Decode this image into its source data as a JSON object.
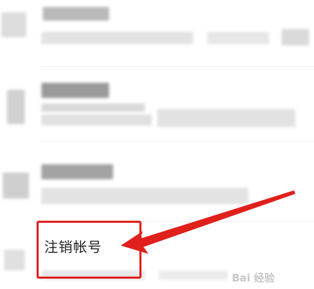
{
  "list": {
    "items": [
      {
        "id": "item-1"
      },
      {
        "id": "item-2"
      },
      {
        "id": "item-3"
      }
    ],
    "cancel_account_label": "注销帐号"
  },
  "annotation": {
    "highlight_color": "#e0201b"
  },
  "watermark": {
    "text": "Bai 经验"
  }
}
